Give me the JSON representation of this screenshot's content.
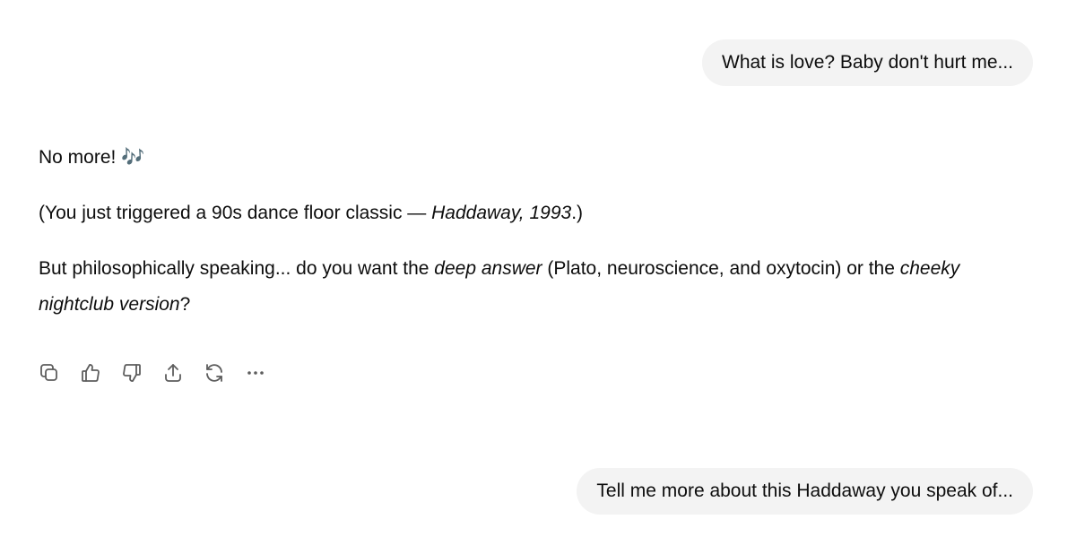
{
  "messages": {
    "user_1": "What is love? Baby don't hurt me...",
    "assistant": {
      "line1": "No more! 🎶",
      "line2_prefix": "(You just triggered a 90s dance floor classic — ",
      "line2_italic": "Haddaway, 1993",
      "line2_suffix": ".)",
      "line3_prefix": "But philosophically speaking... do you want the ",
      "line3_italic1": "deep answer",
      "line3_middle": " (Plato, neuroscience, and oxytocin) or the ",
      "line3_italic2": "cheeky nightclub version",
      "line3_suffix": "?"
    },
    "user_2": "Tell me more about this Haddaway you speak of..."
  },
  "actions": {
    "icons": [
      "copy-icon",
      "thumbs-up-icon",
      "thumbs-down-icon",
      "share-icon",
      "regenerate-icon",
      "more-icon"
    ]
  }
}
